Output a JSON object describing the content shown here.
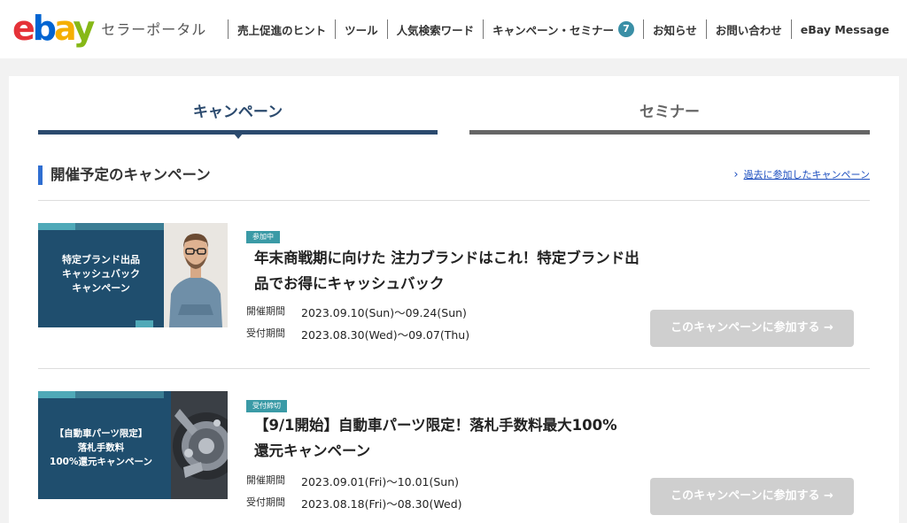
{
  "header": {
    "logo": "ebay",
    "subtitle": "セラーポータル",
    "nav": [
      {
        "label": "売上促進のヒント"
      },
      {
        "label": "ツール"
      },
      {
        "label": "人気検索ワード"
      },
      {
        "label": "キャンペーン・セミナー",
        "badge": "7"
      },
      {
        "label": "お知らせ"
      },
      {
        "label": "お問い合わせ"
      },
      {
        "label": "eBay Message"
      }
    ]
  },
  "tabs": [
    {
      "label": "キャンペーン",
      "active": true
    },
    {
      "label": "セミナー",
      "active": false
    }
  ],
  "section": {
    "title": "開催予定のキャンペーン",
    "past_link": "過去に参加したキャンペーン"
  },
  "campaigns": [
    {
      "banner_text": "特定ブランド出品\nキャッシュバック\nキャンペーン",
      "status": "参加中",
      "title": "年末商戦期に向けた 注力ブランドはこれ！特定ブランド出品でお得にキャッシュバック",
      "event_label": "開催期間",
      "event_period": "2023.09.10(Sun)〜09.24(Sun)",
      "accept_label": "受付期間",
      "accept_period": "2023.08.30(Wed)〜09.07(Thu)",
      "button": "このキャンペーンに参加する →"
    },
    {
      "banner_text": "【自動車パーツ限定】\n落札手数料\n100%還元キャンペーン",
      "status": "受付締切",
      "title": "【9/1開始】自動車パーツ限定！落札手数料最大100%還元キャンペーン",
      "event_label": "開催期間",
      "event_period": "2023.09.01(Fri)〜10.01(Sun)",
      "accept_label": "受付期間",
      "accept_period": "2023.08.18(Fri)〜08.30(Wed)",
      "button": "このキャンペーンに参加する →"
    }
  ],
  "colors": {
    "primary_navy": "#2b4a6e",
    "accent_blue": "#2f6ed1",
    "badge_teal": "#3a9aa6",
    "button_disabled": "#cfcfcf"
  }
}
